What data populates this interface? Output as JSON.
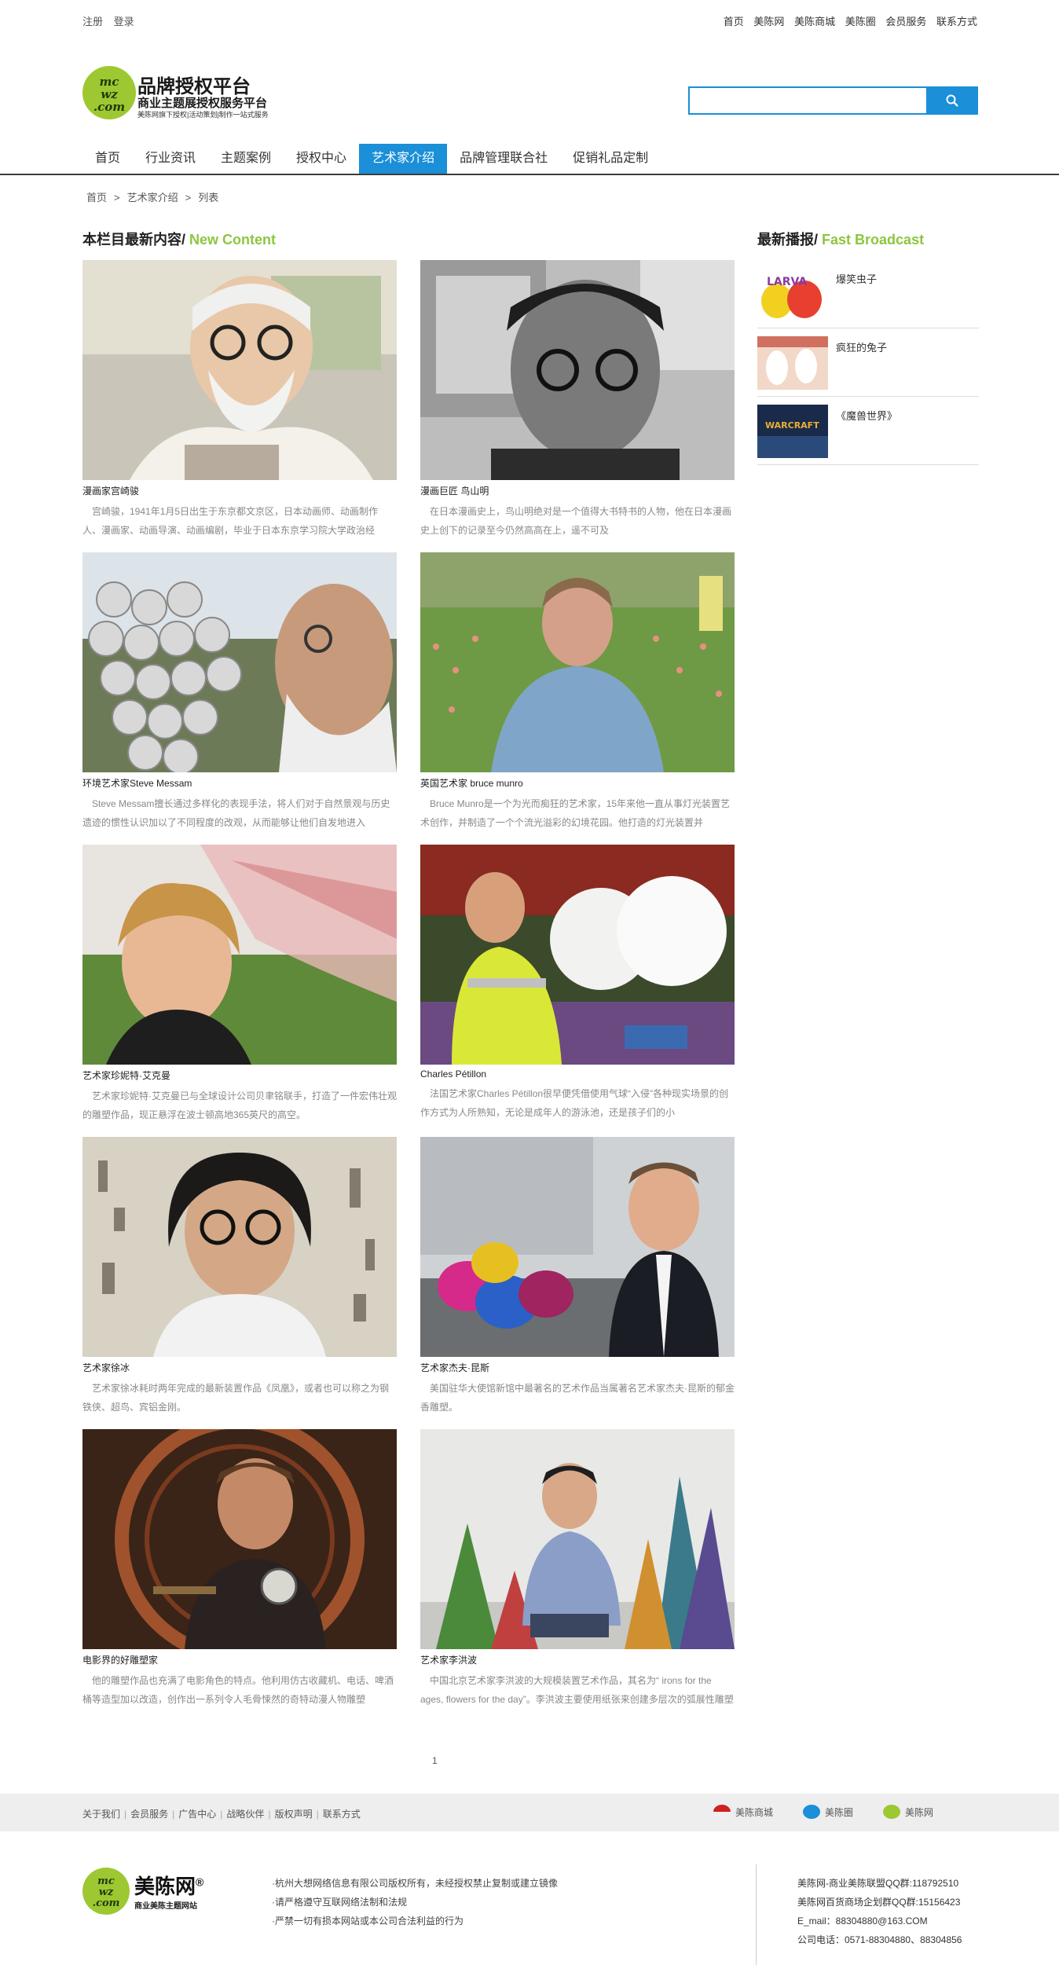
{
  "topbar": {
    "left": [
      "注册",
      "登录"
    ],
    "right": [
      "首页",
      "美陈网",
      "美陈商城",
      "美陈圈",
      "会员服务",
      "联系方式"
    ]
  },
  "logo": {
    "badge": "mcw.com",
    "title": "品牌授权平台",
    "subtitle": "商业主题展授权服务平台",
    "tagline": "美陈网旗下授权|活动策划|制作一站式服务"
  },
  "search": {
    "placeholder": "",
    "value": ""
  },
  "nav": [
    "首页",
    "行业资讯",
    "主题案例",
    "授权中心",
    "艺术家介绍",
    "品牌管理联合社",
    "促销礼品定制"
  ],
  "nav_active": 4,
  "breadcrumb": [
    "首页",
    "艺术家介绍",
    "列表"
  ],
  "breadcrumb_sep": ">",
  "main": {
    "title_cn": "本栏目最新内容/",
    "title_en": "New Content",
    "cards": [
      {
        "name": "漫画家宫崎骏",
        "desc": "宫崎骏，1941年1月5日出生于东京都文京区，日本动画师、动画制作人、漫画家、动画导演、动画编剧，毕业于日本东京学习院大学政治经",
        "img": "portrait-glasses-beard"
      },
      {
        "name": "漫画巨匠 鸟山明",
        "desc": "在日本漫画史上，鸟山明绝对是一个值得大书特书的人物，他在日本漫画史上创下的记录至今仍然高高在上，遥不可及",
        "img": "portrait-bw"
      },
      {
        "name": "环境艺术家Steve Messam",
        "desc": "Steve Messam擅长通过多样化的表现手法，将人们对于自然景观与历史遗迹的惯性认识加以了不同程度的改观，从而能够让他们自发地进入",
        "img": "mirror-balls"
      },
      {
        "name": "英国艺术家 bruce munro",
        "desc": "Bruce Munro是一个为光而痴狂的艺术家，15年来他一直从事灯光装置艺术创作，并制造了一个个流光溢彩的幻境花园。他打造的灯光装置并",
        "img": "field-lights"
      },
      {
        "name": "艺术家珍妮特·艾克曼",
        "desc": "艺术家珍妮特·艾克曼已与全球设计公司贝聿铭联手，打造了一件宏伟壮观的雕塑作品，现正悬浮在波士顿高地365英尺的高空。",
        "img": "net-sculpture"
      },
      {
        "name": "Charles Pétillon",
        "desc": "法国艺术家Charles Pétillon很早便凭借使用气球“入侵”各种现实场景的创作方式为人所熟知，无论是成年人的游泳池，还是孩子们的小",
        "img": "balloons"
      },
      {
        "name": "艺术家徐冰",
        "desc": "艺术家徐冰耗时两年完成的最新装置作品《凤凰》，或者也可以称之为钢铁侠、超鸟、宾铝金刚。",
        "img": "calligraphy"
      },
      {
        "name": "艺术家杰夫·昆斯",
        "desc": "美国驻华大使馆新馆中最著名的艺术作品当属著名艺术家杰夫·昆斯的郁金香雕塑。",
        "img": "balloon-tulips"
      },
      {
        "name": "电影界的好雕塑家",
        "desc": "他的雕塑作品也充满了电影角色的特点。他利用仿古收藏机、电话、啤酒桶等造型加以改造，创作出一系列令人毛骨悚然的奇特动漫人物雕塑",
        "img": "wheel-sculptor"
      },
      {
        "name": "艺术家李洪波",
        "desc": "中国北京艺术家李洪波的大规模装置艺术作品，其名为“ irons for the ages, flowers for the day”。李洪波主要使用纸张来创建多层次的弧展性雕塑",
        "img": "paper-trees"
      }
    ]
  },
  "pager": "1",
  "side": {
    "title_cn": "最新播报/",
    "title_en": "Fast Broadcast",
    "items": [
      {
        "label": "爆笑虫子",
        "img": "larva"
      },
      {
        "label": "疯狂的兔子",
        "img": "rabbids"
      },
      {
        "label": "《魔兽世界》",
        "img": "warcraft"
      }
    ]
  },
  "footer": {
    "links": [
      "关于我们",
      "会员服务",
      "广告中心",
      "战略伙伴",
      "版权声明",
      "联系方式"
    ],
    "partners": [
      "美陈商城",
      "美陈圈",
      "美陈网"
    ],
    "logo_badge": "mcw.com",
    "logo_name": "美陈网",
    "logo_mark": "®",
    "logo_sub": "商业美陈主题网站",
    "notes": [
      "·杭州大想网络信息有限公司版权所有，未经授权禁止复制或建立镜像",
      "·请严格遵守互联网络法制和法规",
      "·严禁一切有损本网站或本公司合法利益的行为"
    ],
    "contact": [
      "美陈网-商业美陈联盟QQ群:118792510",
      "美陈网百货商场企划群QQ群:15156423",
      "E_mail：88304880@163.COM",
      "公司电话：0571-88304880、88304856"
    ]
  },
  "colors": {
    "accent": "#1b8fd8",
    "brand_green": "#8cc63f",
    "footer_bg": "#eeeeee"
  }
}
